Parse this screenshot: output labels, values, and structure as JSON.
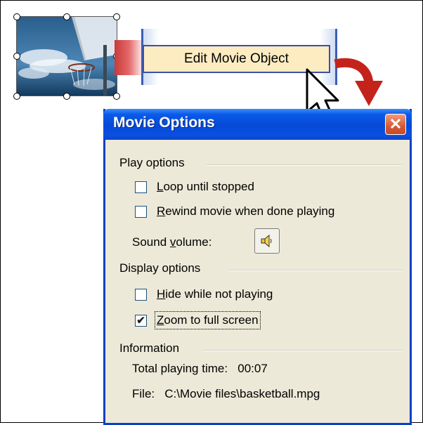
{
  "menu": {
    "edit_movie_object": "Edit Movie Object"
  },
  "dialog": {
    "title": "Movie Options",
    "close_glyph": "✕",
    "play_options": {
      "heading": "Play options",
      "loop": {
        "prefix": "",
        "access": "L",
        "rest": "oop until stopped",
        "checked": false
      },
      "rewind": {
        "prefix": "",
        "access": "R",
        "rest": "ewind movie when done playing",
        "checked": false
      },
      "sound_volume": {
        "prefix": "Sound ",
        "access": "v",
        "rest": "olume:"
      }
    },
    "display_options": {
      "heading": "Display options",
      "hide": {
        "prefix": "",
        "access": "H",
        "rest": "ide while not playing",
        "checked": false
      },
      "zoom": {
        "prefix": "",
        "access": "Z",
        "rest": "oom to full screen",
        "checked": true,
        "check_glyph": "✔"
      }
    },
    "information": {
      "heading": "Information",
      "total_playing_time": "Total playing time:   00:07",
      "file": "File:   C:\\Movie files\\basketball.mpg"
    }
  },
  "icons": {
    "thumbnail": "basketball-hoop-image",
    "speaker": "speaker-icon",
    "arrow": "curved-arrow-icon",
    "cursor": "mouse-pointer-icon"
  }
}
